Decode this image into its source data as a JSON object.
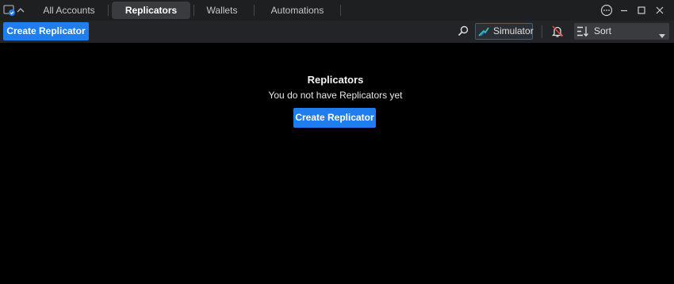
{
  "tabs": [
    {
      "label": "All Accounts",
      "active": false
    },
    {
      "label": "Replicators",
      "active": true
    },
    {
      "label": "Wallets",
      "active": false
    },
    {
      "label": "Automations",
      "active": false
    }
  ],
  "window_controls": [
    "more-icon",
    "minimize-icon",
    "maximize-icon",
    "close-icon"
  ],
  "toolbar": {
    "create_label": "Create Replicator",
    "simulator_label": "Simulator",
    "sort_label": "Sort"
  },
  "empty_state": {
    "title": "Replicators",
    "message": "You do not have Replicators yet",
    "button_label": "Create Replicator"
  },
  "colors": {
    "accent": "#1f7df0",
    "background": "#000000",
    "titlebar": "#1e1f21",
    "toolbar": "#232427",
    "simulator_icon": "#35c3b0",
    "bell_alert": "#e0463c"
  }
}
